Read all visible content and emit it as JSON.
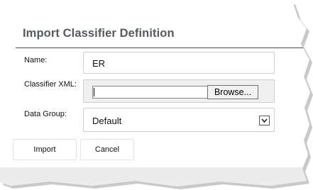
{
  "dialog": {
    "title": "Import Classifier Definition",
    "name_label": "Name:",
    "name_value": "ER",
    "xml_label": "Classifier XML:",
    "browse_label": "Browse...",
    "group_label": "Data Group:",
    "group_value": "Default",
    "import_label": "Import",
    "cancel_label": "Cancel"
  },
  "icons": {
    "dropdown": "chevron-down-icon"
  },
  "colors": {
    "title": "#555a60",
    "rule": "#444444",
    "footer": "#ececec"
  }
}
